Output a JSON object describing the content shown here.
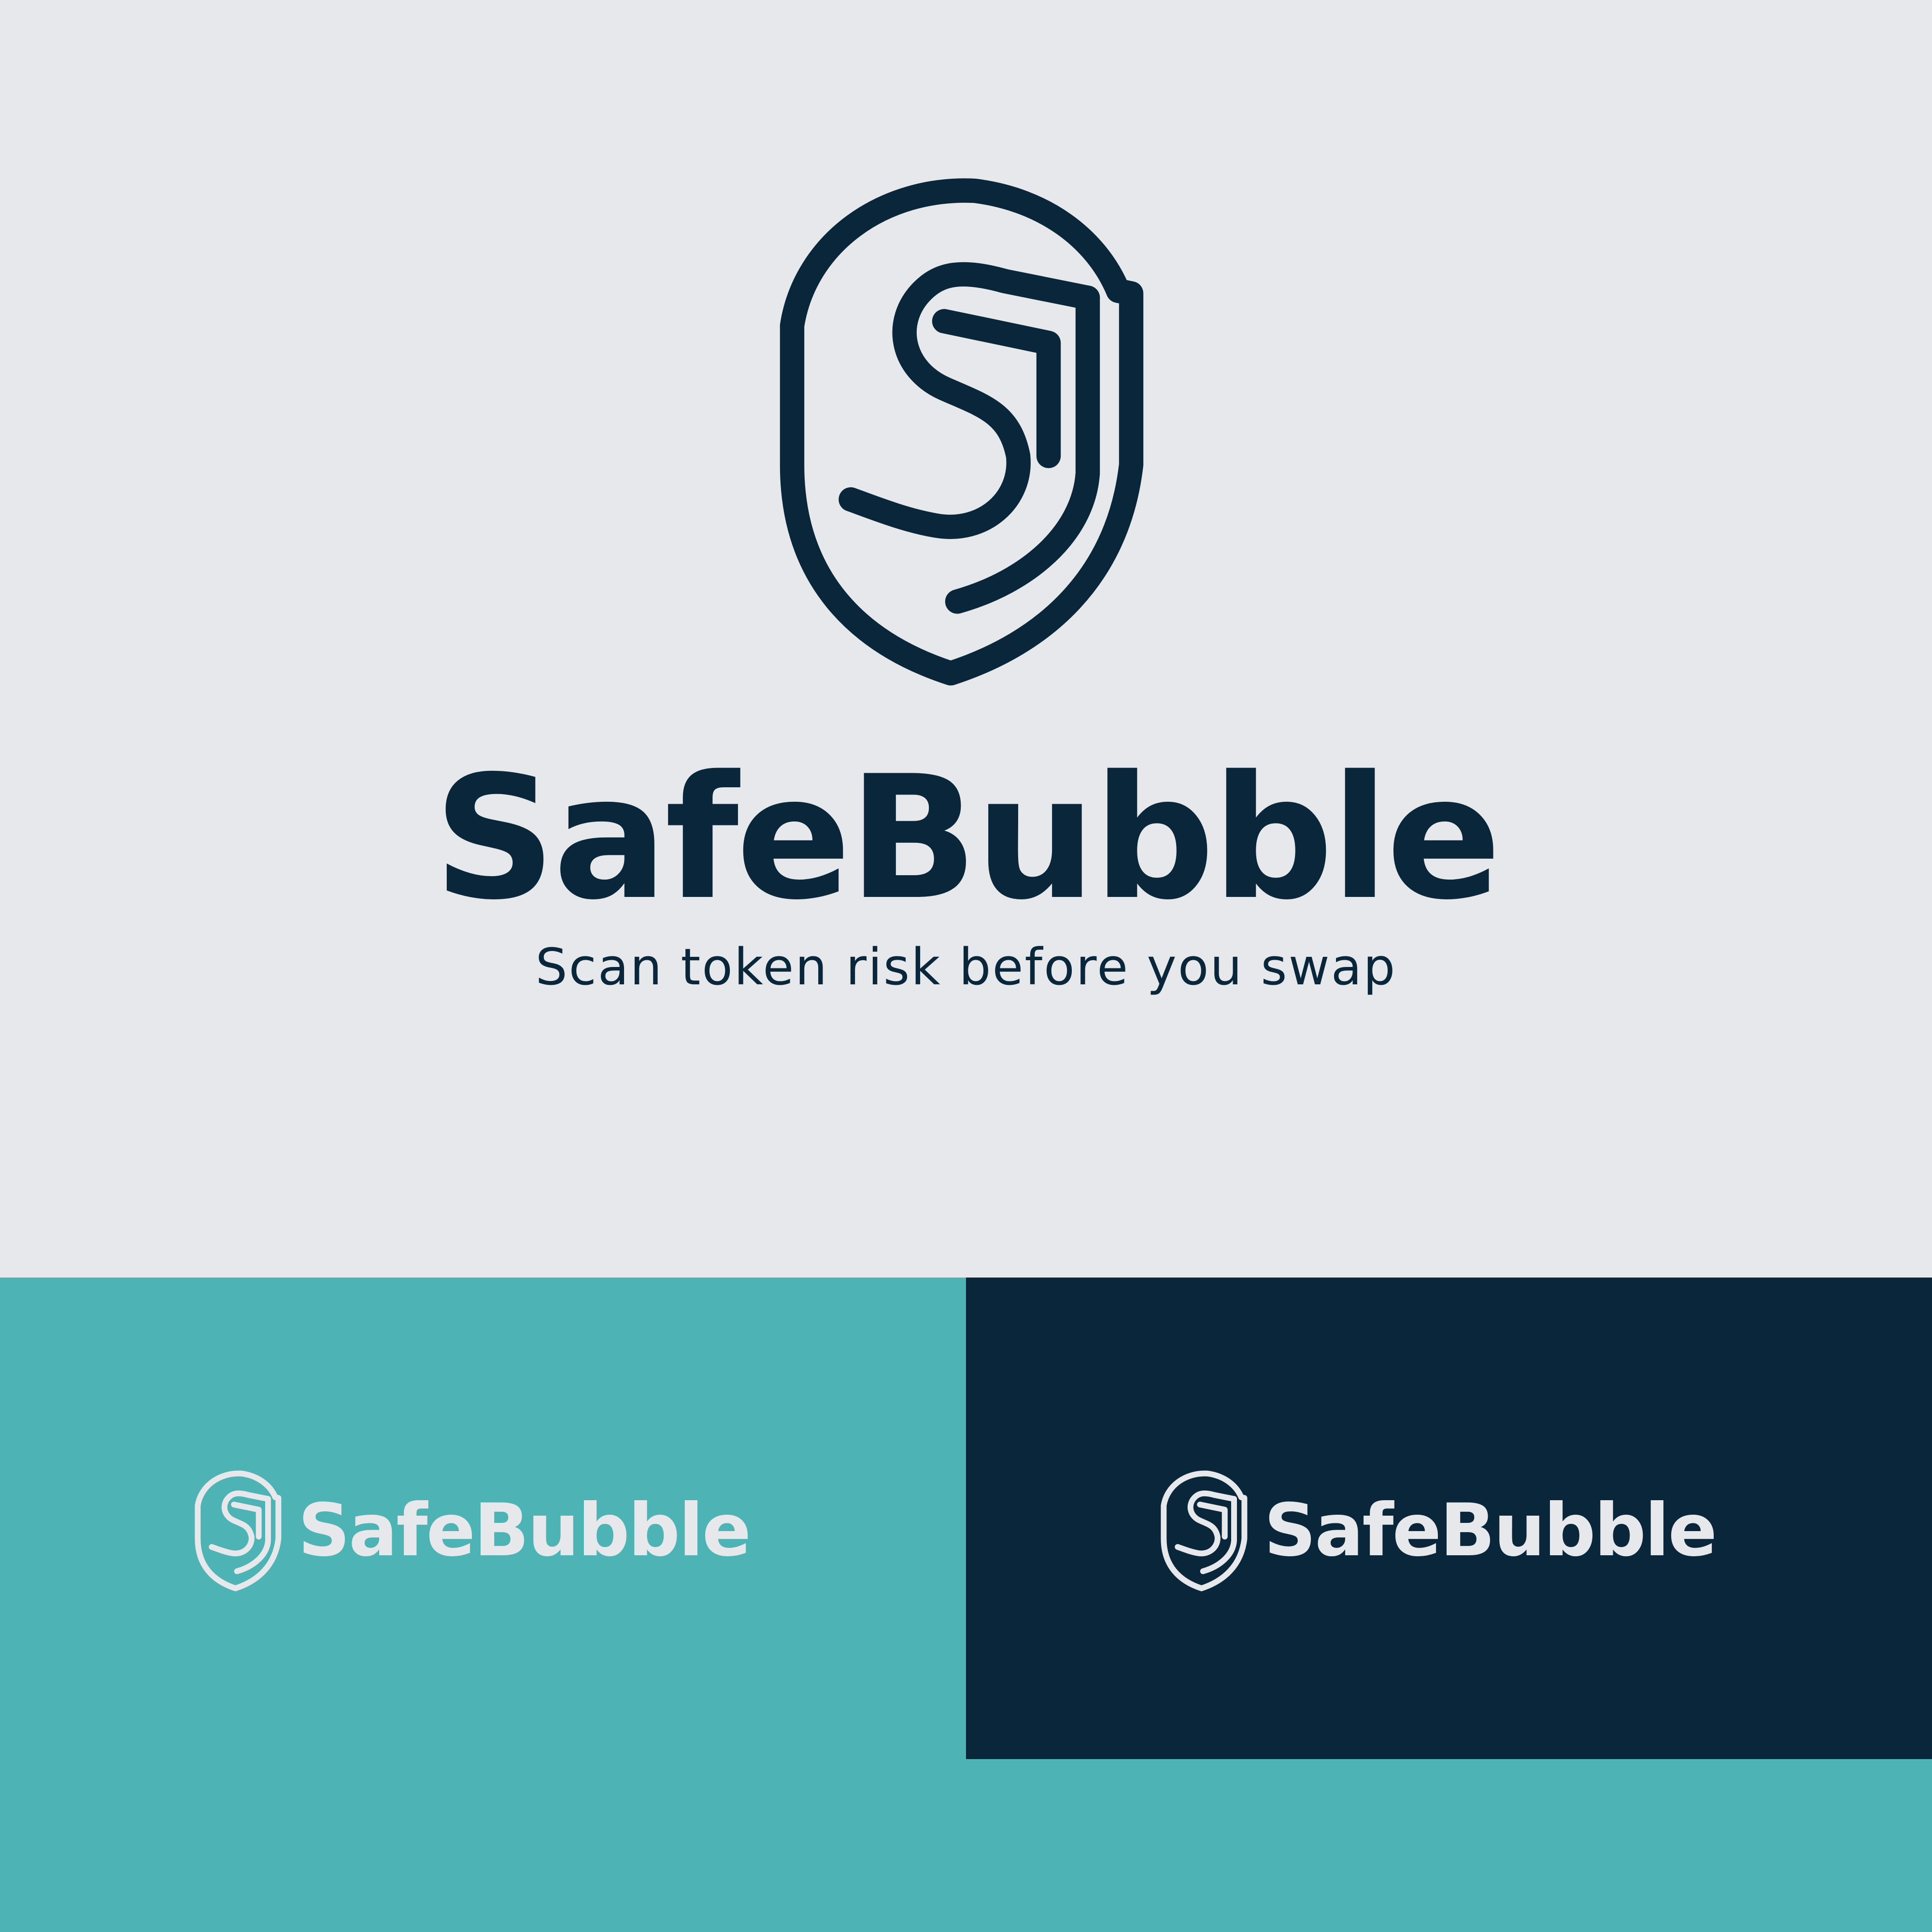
{
  "colors": {
    "background": "#E6E8EC",
    "navy": "#09263B",
    "teal": "#4EB3B4",
    "light": "#E6E8EC"
  },
  "brand": {
    "name": "SafeBubble",
    "tagline": "Scan token risk before you swap"
  },
  "marks": {
    "main_icon": "shield-s-logo-icon",
    "variant_icon": "shield-s-logo-icon"
  }
}
